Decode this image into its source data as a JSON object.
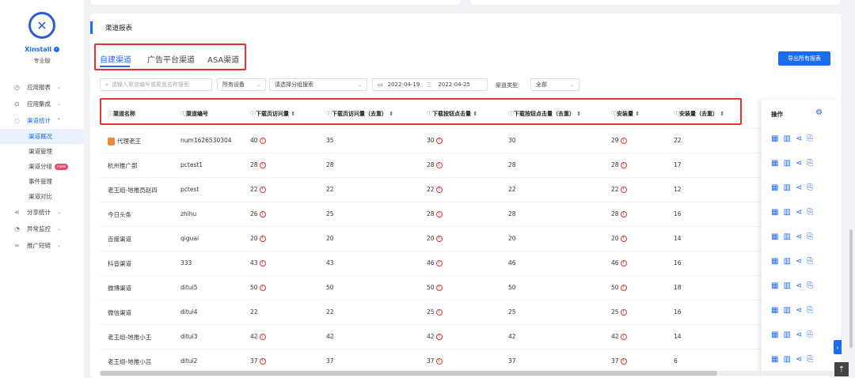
{
  "sidebar": {
    "brand": "Xinstall",
    "edition": "专业版",
    "items": [
      {
        "icon": "chart-icon",
        "glyph": "◷",
        "label": "应用报表"
      },
      {
        "icon": "integration-icon",
        "glyph": "⊙",
        "label": "应用集成"
      },
      {
        "icon": "channel-icon",
        "glyph": "◌",
        "label": "渠道统计"
      }
    ],
    "subs": [
      "渠道概况",
      "渠道管理",
      "渠道分组",
      "事件管理",
      "渠道对比"
    ],
    "sub_badge": "new",
    "items2": [
      {
        "icon": "share-icon",
        "glyph": "⋖",
        "label": "分享统计"
      },
      {
        "icon": "monitor-icon",
        "glyph": "◔",
        "label": "异常监控"
      },
      {
        "icon": "link-icon",
        "glyph": "∞",
        "label": "推广短链"
      }
    ]
  },
  "report": {
    "title": "渠道报表",
    "tabs": [
      "自建渠道",
      "广告平台渠道",
      "ASA渠道"
    ],
    "export_label": "导出所有报表",
    "search_placeholder": "请输入渠道编号或渠道名称搜索",
    "device": "所有设备",
    "group_placeholder": "请选择分组搜索",
    "date_start": "2022-04-19",
    "date_sep": "三",
    "date_end": "2022-04-25",
    "type_label": "渠道类型:",
    "type_value": "全部"
  },
  "table": {
    "headers": [
      "渠道名称",
      "渠道编号",
      "下载页访问量",
      "下载页访问量（去重）",
      "下载按钮点击量",
      "下载按钮点击量（去重）",
      "安装量",
      "安装量（去重）"
    ],
    "ops_header": "操作",
    "rows": [
      [
        "代理老王",
        "num1626530304",
        "40",
        "35",
        "30",
        "30",
        "29",
        "22"
      ],
      [
        "杭州推广部",
        "pctest1",
        "28",
        "28",
        "28",
        "28",
        "28",
        "17"
      ],
      [
        "老王组-地推员赵四",
        "pctest",
        "22",
        "22",
        "22",
        "22",
        "22",
        "12"
      ],
      [
        "今日头条",
        "zhihu",
        "26",
        "25",
        "28",
        "28",
        "28",
        "16"
      ],
      [
        "百度渠道",
        "qiguai",
        "20",
        "20",
        "20",
        "20",
        "20",
        "14"
      ],
      [
        "抖音渠道",
        "333",
        "43",
        "43",
        "46",
        "46",
        "46",
        "16"
      ],
      [
        "微博渠道",
        "ditui5",
        "50",
        "50",
        "50",
        "50",
        "50",
        "18"
      ],
      [
        "微信渠道",
        "ditui4",
        "22",
        "22",
        "25",
        "25",
        "25",
        "16"
      ],
      [
        "老王组-地推小王",
        "ditui3",
        "42",
        "42",
        "42",
        "42",
        "42",
        "14"
      ],
      [
        "老王组-地推小吕",
        "ditui2",
        "37",
        "37",
        "37",
        "37",
        "37",
        "6"
      ]
    ]
  }
}
